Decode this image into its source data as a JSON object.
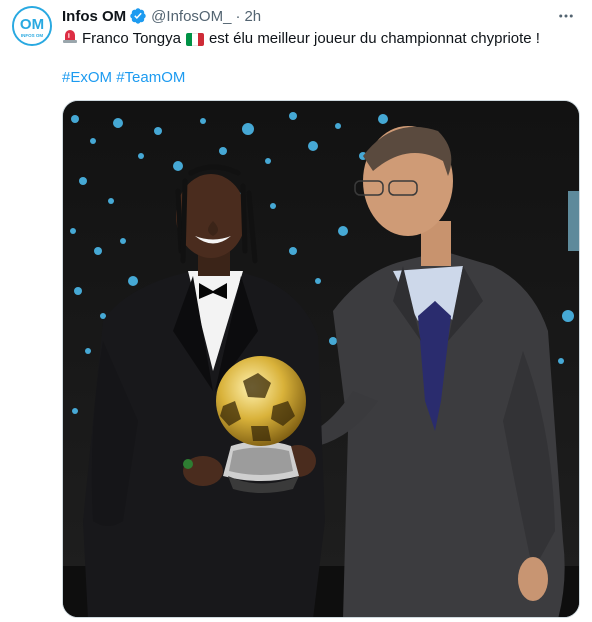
{
  "author": {
    "name": "Infos OM",
    "handle": "@InfosOM_",
    "separator": "·",
    "time": "2h",
    "avatar_text": "OM",
    "avatar_subtext": "INFOS OM",
    "verified_icon": "verified-badge-icon"
  },
  "tweet": {
    "siren_icon": "rotating-light-icon",
    "text_before_flag": "Franco Tongya",
    "flag_icon": "italy-flag-icon",
    "flag_colors": [
      "#009246",
      "#ffffff",
      "#ce2b37"
    ],
    "text_after_flag": "est élu meilleur joueur du championnat chypriote !",
    "hashtags": [
      "#ExOM",
      "#TeamOM"
    ]
  },
  "media": {
    "type": "photo",
    "subject": "award-ceremony-photo"
  },
  "colors": {
    "accent": "#1d9bf0",
    "verified": "#1d9bf0",
    "secondary_text": "#536471",
    "avatar_ring": "#29a9e1"
  }
}
